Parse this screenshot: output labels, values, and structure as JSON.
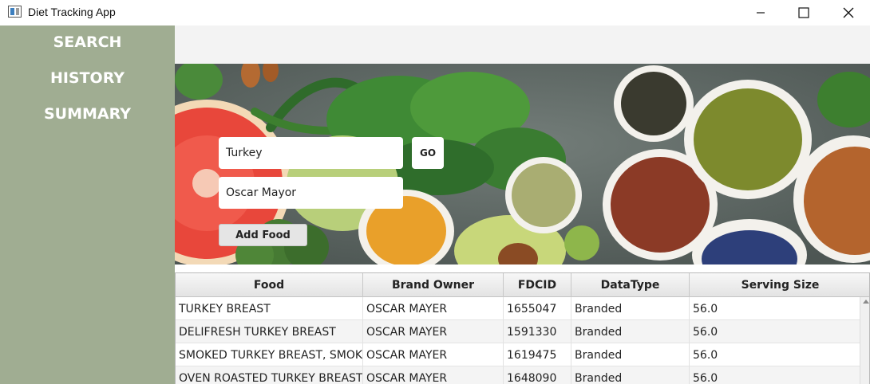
{
  "window": {
    "title": "Diet Tracking App"
  },
  "sidebar": {
    "items": [
      {
        "label": "SEARCH"
      },
      {
        "label": "HISTORY"
      },
      {
        "label": "SUMMARY"
      }
    ]
  },
  "search": {
    "food_value": "Turkey",
    "brand_value": "Oscar Mayor",
    "go_label": "GO",
    "add_label": "Add Food"
  },
  "table": {
    "columns": [
      "Food",
      "Brand Owner",
      "FDCID",
      "DataType",
      "Serving Size"
    ],
    "rows": [
      [
        "TURKEY BREAST",
        "OSCAR MAYER",
        "1655047",
        "Branded",
        "56.0"
      ],
      [
        "DELIFRESH TURKEY BREAST",
        "OSCAR MAYER",
        "1591330",
        "Branded",
        "56.0"
      ],
      [
        "SMOKED TURKEY BREAST, SMOK...",
        "OSCAR MAYER",
        "1619475",
        "Branded",
        "56.0"
      ],
      [
        "OVEN ROASTED TURKEY BREAST",
        "OSCAR MAYER",
        "1648090",
        "Branded",
        "56.0"
      ]
    ]
  },
  "colors": {
    "sidebar": "#a0ad92",
    "banner_bg": "#5f6a66"
  }
}
